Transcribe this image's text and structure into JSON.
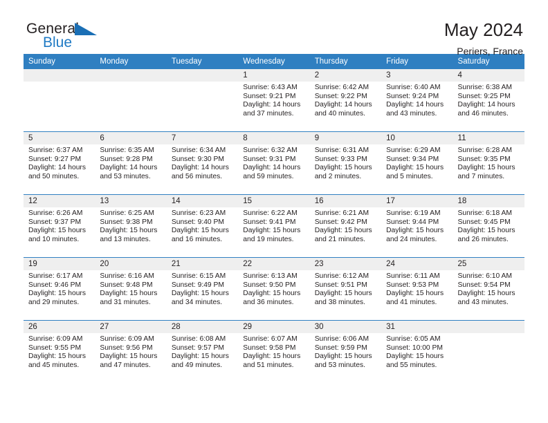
{
  "brand": {
    "name_part1": "General",
    "name_part2": "Blue",
    "triangle_color": "#1a6fb5",
    "blue_color": "#1f7ac4"
  },
  "header": {
    "title": "May 2024",
    "subtitle": "Periers, France"
  },
  "theme": {
    "header_blue": "#2f7fc1",
    "daynum_gray": "#efefef",
    "text": "#231f20"
  },
  "weekday_headers": [
    "Sunday",
    "Monday",
    "Tuesday",
    "Wednesday",
    "Thursday",
    "Friday",
    "Saturday"
  ],
  "weeks": [
    [
      {
        "day": "",
        "sunrise": "",
        "sunset": "",
        "daylight1": "",
        "daylight2": ""
      },
      {
        "day": "",
        "sunrise": "",
        "sunset": "",
        "daylight1": "",
        "daylight2": ""
      },
      {
        "day": "",
        "sunrise": "",
        "sunset": "",
        "daylight1": "",
        "daylight2": ""
      },
      {
        "day": "1",
        "sunrise": "Sunrise: 6:43 AM",
        "sunset": "Sunset: 9:21 PM",
        "daylight1": "Daylight: 14 hours",
        "daylight2": "and 37 minutes."
      },
      {
        "day": "2",
        "sunrise": "Sunrise: 6:42 AM",
        "sunset": "Sunset: 9:22 PM",
        "daylight1": "Daylight: 14 hours",
        "daylight2": "and 40 minutes."
      },
      {
        "day": "3",
        "sunrise": "Sunrise: 6:40 AM",
        "sunset": "Sunset: 9:24 PM",
        "daylight1": "Daylight: 14 hours",
        "daylight2": "and 43 minutes."
      },
      {
        "day": "4",
        "sunrise": "Sunrise: 6:38 AM",
        "sunset": "Sunset: 9:25 PM",
        "daylight1": "Daylight: 14 hours",
        "daylight2": "and 46 minutes."
      }
    ],
    [
      {
        "day": "5",
        "sunrise": "Sunrise: 6:37 AM",
        "sunset": "Sunset: 9:27 PM",
        "daylight1": "Daylight: 14 hours",
        "daylight2": "and 50 minutes."
      },
      {
        "day": "6",
        "sunrise": "Sunrise: 6:35 AM",
        "sunset": "Sunset: 9:28 PM",
        "daylight1": "Daylight: 14 hours",
        "daylight2": "and 53 minutes."
      },
      {
        "day": "7",
        "sunrise": "Sunrise: 6:34 AM",
        "sunset": "Sunset: 9:30 PM",
        "daylight1": "Daylight: 14 hours",
        "daylight2": "and 56 minutes."
      },
      {
        "day": "8",
        "sunrise": "Sunrise: 6:32 AM",
        "sunset": "Sunset: 9:31 PM",
        "daylight1": "Daylight: 14 hours",
        "daylight2": "and 59 minutes."
      },
      {
        "day": "9",
        "sunrise": "Sunrise: 6:31 AM",
        "sunset": "Sunset: 9:33 PM",
        "daylight1": "Daylight: 15 hours",
        "daylight2": "and 2 minutes."
      },
      {
        "day": "10",
        "sunrise": "Sunrise: 6:29 AM",
        "sunset": "Sunset: 9:34 PM",
        "daylight1": "Daylight: 15 hours",
        "daylight2": "and 5 minutes."
      },
      {
        "day": "11",
        "sunrise": "Sunrise: 6:28 AM",
        "sunset": "Sunset: 9:35 PM",
        "daylight1": "Daylight: 15 hours",
        "daylight2": "and 7 minutes."
      }
    ],
    [
      {
        "day": "12",
        "sunrise": "Sunrise: 6:26 AM",
        "sunset": "Sunset: 9:37 PM",
        "daylight1": "Daylight: 15 hours",
        "daylight2": "and 10 minutes."
      },
      {
        "day": "13",
        "sunrise": "Sunrise: 6:25 AM",
        "sunset": "Sunset: 9:38 PM",
        "daylight1": "Daylight: 15 hours",
        "daylight2": "and 13 minutes."
      },
      {
        "day": "14",
        "sunrise": "Sunrise: 6:23 AM",
        "sunset": "Sunset: 9:40 PM",
        "daylight1": "Daylight: 15 hours",
        "daylight2": "and 16 minutes."
      },
      {
        "day": "15",
        "sunrise": "Sunrise: 6:22 AM",
        "sunset": "Sunset: 9:41 PM",
        "daylight1": "Daylight: 15 hours",
        "daylight2": "and 19 minutes."
      },
      {
        "day": "16",
        "sunrise": "Sunrise: 6:21 AM",
        "sunset": "Sunset: 9:42 PM",
        "daylight1": "Daylight: 15 hours",
        "daylight2": "and 21 minutes."
      },
      {
        "day": "17",
        "sunrise": "Sunrise: 6:19 AM",
        "sunset": "Sunset: 9:44 PM",
        "daylight1": "Daylight: 15 hours",
        "daylight2": "and 24 minutes."
      },
      {
        "day": "18",
        "sunrise": "Sunrise: 6:18 AM",
        "sunset": "Sunset: 9:45 PM",
        "daylight1": "Daylight: 15 hours",
        "daylight2": "and 26 minutes."
      }
    ],
    [
      {
        "day": "19",
        "sunrise": "Sunrise: 6:17 AM",
        "sunset": "Sunset: 9:46 PM",
        "daylight1": "Daylight: 15 hours",
        "daylight2": "and 29 minutes."
      },
      {
        "day": "20",
        "sunrise": "Sunrise: 6:16 AM",
        "sunset": "Sunset: 9:48 PM",
        "daylight1": "Daylight: 15 hours",
        "daylight2": "and 31 minutes."
      },
      {
        "day": "21",
        "sunrise": "Sunrise: 6:15 AM",
        "sunset": "Sunset: 9:49 PM",
        "daylight1": "Daylight: 15 hours",
        "daylight2": "and 34 minutes."
      },
      {
        "day": "22",
        "sunrise": "Sunrise: 6:13 AM",
        "sunset": "Sunset: 9:50 PM",
        "daylight1": "Daylight: 15 hours",
        "daylight2": "and 36 minutes."
      },
      {
        "day": "23",
        "sunrise": "Sunrise: 6:12 AM",
        "sunset": "Sunset: 9:51 PM",
        "daylight1": "Daylight: 15 hours",
        "daylight2": "and 38 minutes."
      },
      {
        "day": "24",
        "sunrise": "Sunrise: 6:11 AM",
        "sunset": "Sunset: 9:53 PM",
        "daylight1": "Daylight: 15 hours",
        "daylight2": "and 41 minutes."
      },
      {
        "day": "25",
        "sunrise": "Sunrise: 6:10 AM",
        "sunset": "Sunset: 9:54 PM",
        "daylight1": "Daylight: 15 hours",
        "daylight2": "and 43 minutes."
      }
    ],
    [
      {
        "day": "26",
        "sunrise": "Sunrise: 6:09 AM",
        "sunset": "Sunset: 9:55 PM",
        "daylight1": "Daylight: 15 hours",
        "daylight2": "and 45 minutes."
      },
      {
        "day": "27",
        "sunrise": "Sunrise: 6:09 AM",
        "sunset": "Sunset: 9:56 PM",
        "daylight1": "Daylight: 15 hours",
        "daylight2": "and 47 minutes."
      },
      {
        "day": "28",
        "sunrise": "Sunrise: 6:08 AM",
        "sunset": "Sunset: 9:57 PM",
        "daylight1": "Daylight: 15 hours",
        "daylight2": "and 49 minutes."
      },
      {
        "day": "29",
        "sunrise": "Sunrise: 6:07 AM",
        "sunset": "Sunset: 9:58 PM",
        "daylight1": "Daylight: 15 hours",
        "daylight2": "and 51 minutes."
      },
      {
        "day": "30",
        "sunrise": "Sunrise: 6:06 AM",
        "sunset": "Sunset: 9:59 PM",
        "daylight1": "Daylight: 15 hours",
        "daylight2": "and 53 minutes."
      },
      {
        "day": "31",
        "sunrise": "Sunrise: 6:05 AM",
        "sunset": "Sunset: 10:00 PM",
        "daylight1": "Daylight: 15 hours",
        "daylight2": "and 55 minutes."
      },
      {
        "day": "",
        "sunrise": "",
        "sunset": "",
        "daylight1": "",
        "daylight2": ""
      }
    ]
  ]
}
